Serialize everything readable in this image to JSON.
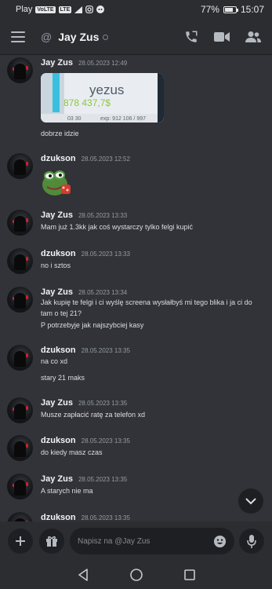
{
  "status_bar": {
    "carrier": "Play",
    "tags": [
      "VoLTE",
      "LTE"
    ],
    "battery_percent": "77%",
    "battery_level": 0.77,
    "time": "15:07"
  },
  "header": {
    "title": "Jay Zus",
    "at_symbol": "@",
    "icons": [
      "menu-icon",
      "phone-icon",
      "video-icon",
      "members-icon"
    ]
  },
  "messages": [
    {
      "author": "Jay Zus",
      "time": "28.05.2023 12:49",
      "lines": [
        "dobrze idzie"
      ],
      "image": {
        "title": "yezus",
        "value": "878 437,7$",
        "label_left": "03 30",
        "label_right": "exp: 912 106 / 997"
      }
    },
    {
      "author": "dzukson",
      "time": "28.05.2023 12:52",
      "lines": [],
      "sticker": "pepe-sticker"
    },
    {
      "author": "Jay Zus",
      "time": "28.05.2023 13:33",
      "lines": [
        "Mam już 1.3kk jak coś wystarczy tylko felgi kupić"
      ]
    },
    {
      "author": "dzukson",
      "time": "28.05.2023 13:33",
      "lines": [
        "no i sztos"
      ]
    },
    {
      "author": "Jay Zus",
      "time": "28.05.2023 13:34",
      "lines": [
        "Jak kupię te felgi i ci wyślę screena wysłałbyś mi tego blika i ja ci do tam o tej 21?",
        "P potrzebyje jak najszybciej kasy"
      ]
    },
    {
      "author": "dzukson",
      "time": "28.05.2023 13:35",
      "lines": [
        "na co xd",
        "stary 21 maks"
      ]
    },
    {
      "author": "Jay Zus",
      "time": "28.05.2023 13:35",
      "lines": [
        "Musze zapłacić ratę za telefon  xd"
      ]
    },
    {
      "author": "dzukson",
      "time": "28.05.2023 13:35",
      "lines": [
        "do kiedy masz czas"
      ]
    },
    {
      "author": "Jay Zus",
      "time": "28.05.2023 13:35",
      "lines": [
        "A starych nie ma"
      ]
    },
    {
      "author": "dzukson",
      "time": "28.05.2023 13:35",
      "lines": []
    }
  ],
  "composer": {
    "placeholder": "Napisz na @Jay Zus",
    "icons": [
      "plus-icon",
      "gift-icon",
      "emoji-icon",
      "microphone-icon"
    ]
  },
  "nav": {
    "icons": [
      "back-icon",
      "home-icon",
      "recents-icon"
    ]
  },
  "colors": {
    "background": "#313338",
    "bar": "#2b2d31",
    "input": "#1e1f22",
    "text": "#dbdee1",
    "muted": "#949ba4"
  }
}
